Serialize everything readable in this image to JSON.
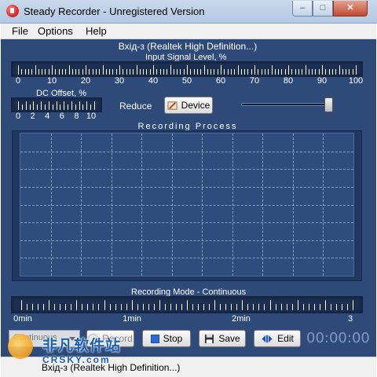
{
  "window": {
    "title": "Steady Recorder - Unregistered Version"
  },
  "menu": {
    "items": [
      "File",
      "Options",
      "Help"
    ]
  },
  "device_title": "Вхід-з (Realtek High Definition...)",
  "input_signal": {
    "label": "Input Signal Level, %",
    "scale": [
      "0",
      "10",
      "20",
      "30",
      "40",
      "50",
      "60",
      "70",
      "80",
      "90",
      "100"
    ]
  },
  "dc_offset": {
    "label": "DC Offset, %",
    "scale": [
      "0",
      "2",
      "4",
      "6",
      "8",
      "10"
    ]
  },
  "reduce_label": "Reduce",
  "device_button": "Device",
  "recording_process_label": "Recording Process",
  "recording_mode": {
    "label": "Recording Mode - Continuous",
    "scale": [
      "0min",
      "1min",
      "2min",
      "3"
    ]
  },
  "controls": {
    "mode_select": "Continuous",
    "record": "Record",
    "stop": "Stop",
    "save": "Save",
    "edit": "Edit"
  },
  "timer": "00:00:00",
  "status": "Вхід-з (Realtek High Definition...)",
  "watermark": {
    "main": "非凡软件站",
    "sub": "CRSKY.com"
  },
  "colors": {
    "panel": "#2e4a78",
    "graph": "#2f4d7c",
    "timer": "#7f98c2"
  }
}
